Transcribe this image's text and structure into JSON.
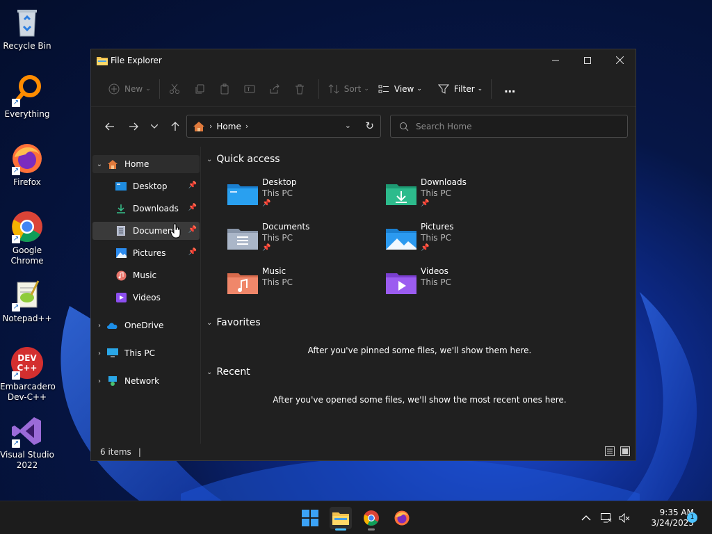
{
  "desktop": {
    "icons": [
      {
        "label": "Recycle Bin"
      },
      {
        "label": "Everything"
      },
      {
        "label": "Firefox"
      },
      {
        "label": "Google Chrome"
      },
      {
        "label": "Notepad++"
      },
      {
        "label": "Embarcadero Dev-C++"
      },
      {
        "label": "Visual Studio 2022"
      }
    ]
  },
  "window": {
    "title": "File Explorer",
    "toolbar": {
      "new_label": "New",
      "sort_label": "Sort",
      "view_label": "View",
      "filter_label": "Filter",
      "more_label": "…"
    },
    "address": {
      "crumb": "Home"
    },
    "search": {
      "placeholder": "Search Home"
    },
    "sidebar": {
      "items": [
        {
          "label": "Home"
        },
        {
          "label": "Desktop"
        },
        {
          "label": "Downloads"
        },
        {
          "label": "Document"
        },
        {
          "label": "Pictures"
        },
        {
          "label": "Music"
        },
        {
          "label": "Videos"
        },
        {
          "label": "OneDrive"
        },
        {
          "label": "This PC"
        },
        {
          "label": "Network"
        }
      ]
    },
    "quick_access": {
      "title": "Quick access",
      "items": [
        {
          "name": "Desktop",
          "location": "This PC"
        },
        {
          "name": "Downloads",
          "location": "This PC"
        },
        {
          "name": "Documents",
          "location": "This PC"
        },
        {
          "name": "Pictures",
          "location": "This PC"
        },
        {
          "name": "Music",
          "location": "This PC"
        },
        {
          "name": "Videos",
          "location": "This PC"
        }
      ]
    },
    "favorites": {
      "title": "Favorites",
      "empty_message": "After you've pinned some files, we'll show them here."
    },
    "recent": {
      "title": "Recent",
      "empty_message": "After you've opened some files, we'll show the most recent ones here."
    },
    "status": {
      "item_count": "6 items"
    }
  },
  "taskbar": {
    "time": "9:35 AM",
    "date": "3/24/2023",
    "notification_count": "1"
  }
}
